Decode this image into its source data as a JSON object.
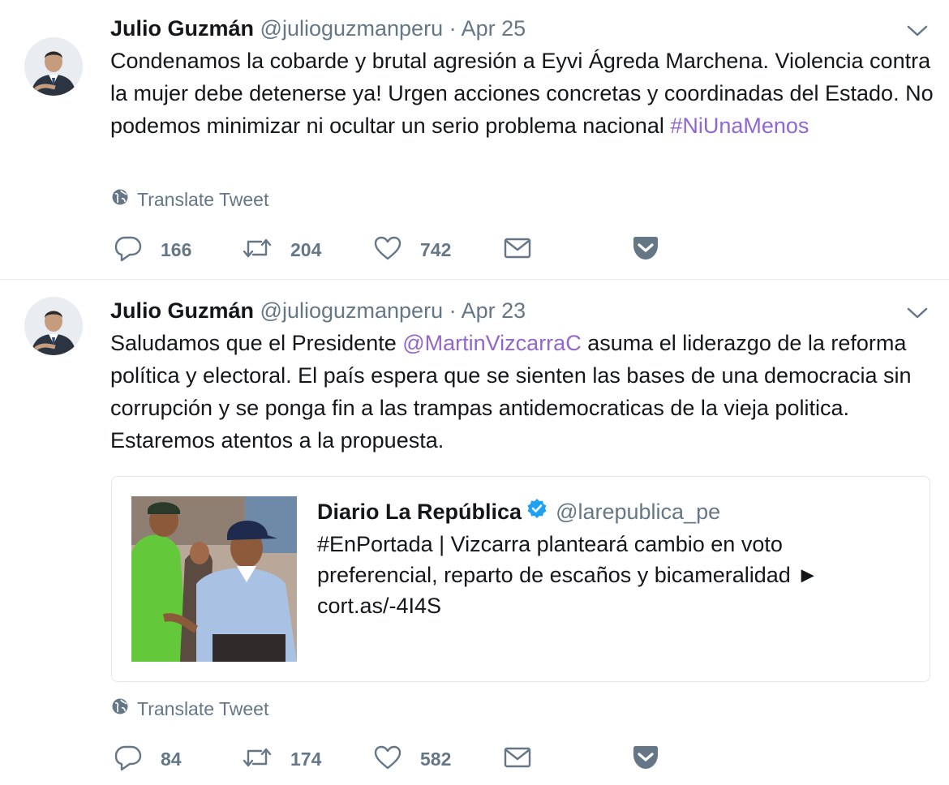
{
  "colors": {
    "text": "#14171a",
    "secondary": "#657786",
    "link": "#9266cc",
    "verified": "#1da1f2",
    "divider": "#e6ecf0"
  },
  "tweets": [
    {
      "author_name": "Julio Guzmán",
      "author_handle": "@julioguzmanperu",
      "separator": "·",
      "date": "Apr 25",
      "text_before": "Condenamos la cobarde y brutal agresión a Eyvi Ágreda Marchena. Violencia contra la mujer debe detenerse ya! Urgen acciones concretas y coordinadas del Estado. No podemos minimizar ni ocultar un serio problema nacional ",
      "hashtag": "#NiUnaMenos",
      "translate_label": "Translate Tweet",
      "replies": "166",
      "retweets": "204",
      "likes": "742"
    },
    {
      "author_name": "Julio Guzmán",
      "author_handle": "@julioguzmanperu",
      "separator": "·",
      "date": "Apr 23",
      "text_before": "Saludamos que el Presidente ",
      "mention": "@MartinVizcarraC",
      "text_after": " asuma el liderazgo de la reforma política y electoral. El país espera que se sienten las bases de una democracia sin corrupción y se ponga fin a las trampas antidemocraticas de la vieja politica. Estaremos atentos a la propuesta.",
      "quoted": {
        "name": "Diario La República",
        "handle": "@larepublica_pe",
        "text": "#EnPortada | Vizcarra planteará cambio en voto preferencial, reparto de escaños y bicameralidad ► cort.as/-4I4S"
      },
      "translate_label": "Translate Tweet",
      "replies": "84",
      "retweets": "174",
      "likes": "582"
    }
  ],
  "icons": {
    "reply": "reply-icon",
    "retweet": "retweet-icon",
    "like": "heart-icon",
    "dm": "envelope-icon",
    "pocket": "pocket-icon",
    "more": "chevron-down-icon",
    "translate": "globe-icon",
    "verified": "verified-badge-icon"
  }
}
